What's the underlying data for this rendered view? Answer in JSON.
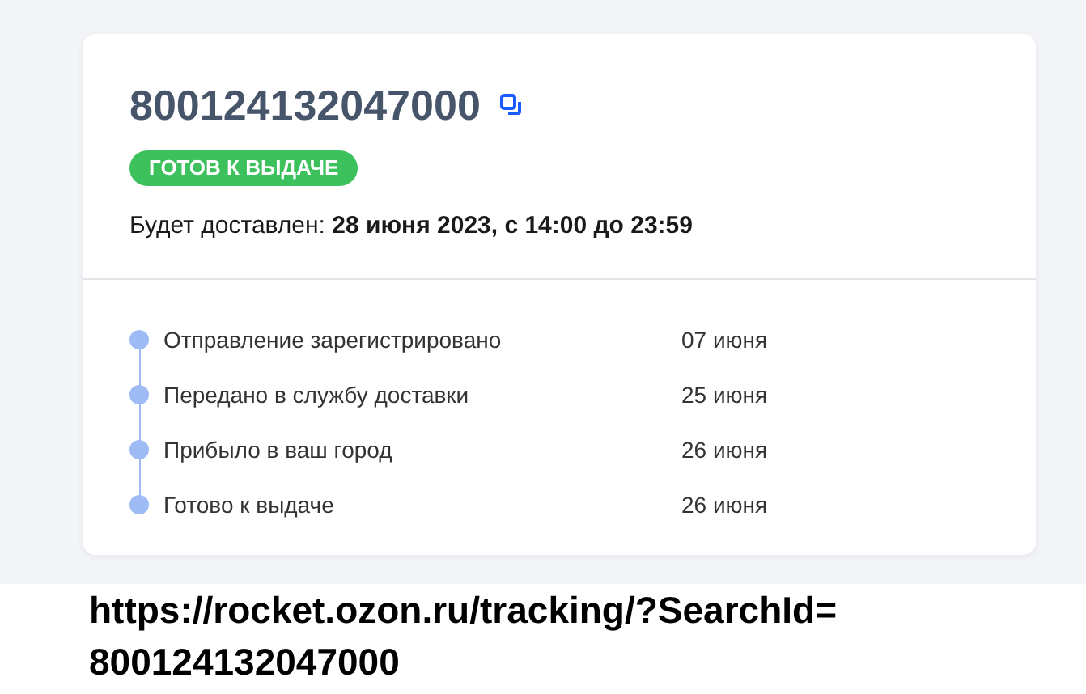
{
  "tracking_number": "800124132047000",
  "status_badge": "ГОТОВ К ВЫДАЧЕ",
  "delivery_text": "Будет доставлен: **28 июня 2023, с 14:00 до 23:59**",
  "timeline": [
    {
      "event": "Отправление зарегистрировано",
      "date": "07 июня"
    },
    {
      "event": "Передано в службу доставки",
      "date": "25 июня"
    },
    {
      "event": "Прибыло в ваш город",
      "date": "26 июня"
    },
    {
      "event": "Готово к выдаче",
      "date": "26 июня"
    }
  ],
  "caption": [
    "https://rocket.ozon.ru/tracking/?SearchId=",
    "800124132047000"
  ]
}
